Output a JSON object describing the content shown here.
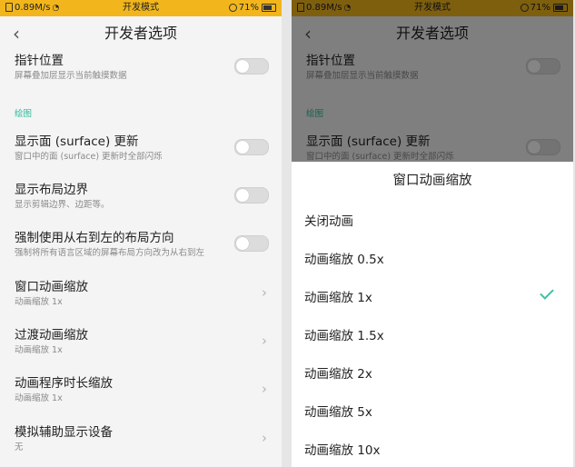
{
  "status_bar": {
    "speed": "0.89M/s",
    "mode": "开发模式",
    "battery": "71%"
  },
  "left": {
    "title": "开发者选项",
    "rows": [
      {
        "title": "指针位置",
        "subtitle": "屏幕叠加层显示当前触摸数据"
      },
      {
        "title": "显示面 (surface) 更新",
        "subtitle": "窗口中的面 (surface) 更新时全部闪烁"
      },
      {
        "title": "显示布局边界",
        "subtitle": "显示剪辑边界、边距等。"
      },
      {
        "title": "强制使用从右到左的布局方向",
        "subtitle": "强制将所有语言区域的屏幕布局方向改为从右到左"
      },
      {
        "title": "窗口动画缩放",
        "subtitle": "动画缩放 1x"
      },
      {
        "title": "过渡动画缩放",
        "subtitle": "动画缩放 1x"
      },
      {
        "title": "动画程序时长缩放",
        "subtitle": "动画缩放 1x"
      },
      {
        "title": "模拟辅助显示设备",
        "subtitle": "无"
      }
    ],
    "section_label": "绘图"
  },
  "right": {
    "title": "开发者选项",
    "bg_rows": [
      {
        "title": "指针位置",
        "subtitle": "屏幕叠加层显示当前触摸数据"
      },
      {
        "title": "显示面 (surface) 更新",
        "subtitle": "窗口中的面 (surface) 更新时全部闪烁"
      }
    ],
    "section_label": "绘图",
    "dialog": {
      "title": "窗口动画缩放",
      "options": [
        "关闭动画",
        "动画缩放 0.5x",
        "动画缩放 1x",
        "动画缩放 1.5x",
        "动画缩放 2x",
        "动画缩放 5x",
        "动画缩放 10x"
      ],
      "selected": "动画缩放 1x"
    }
  },
  "icons": {
    "back": "back-arrow-icon",
    "chevron": "chevron-right-icon",
    "check": "check-icon"
  },
  "colors": {
    "status_bar": "#f2b61c",
    "accent": "#3cc3a3",
    "section": "#2bb89a"
  }
}
